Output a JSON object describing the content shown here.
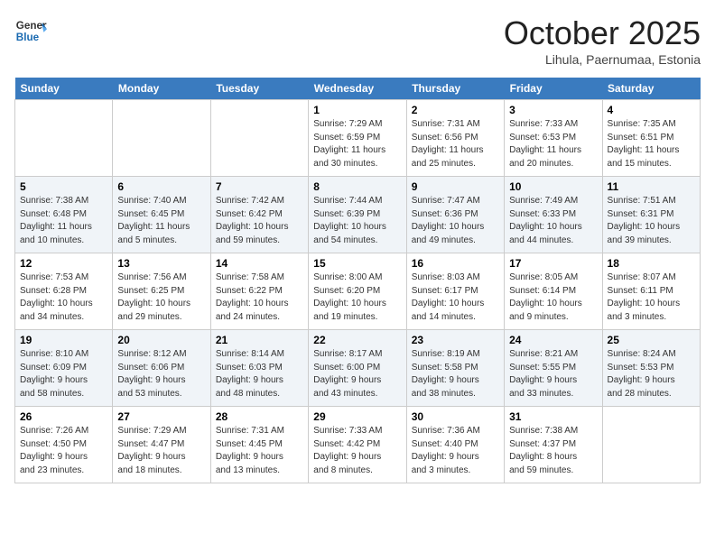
{
  "header": {
    "logo_line1": "General",
    "logo_line2": "Blue",
    "month": "October 2025",
    "location": "Lihula, Paernumaa, Estonia"
  },
  "days_of_week": [
    "Sunday",
    "Monday",
    "Tuesday",
    "Wednesday",
    "Thursday",
    "Friday",
    "Saturday"
  ],
  "weeks": [
    [
      {
        "day": "",
        "info": ""
      },
      {
        "day": "",
        "info": ""
      },
      {
        "day": "",
        "info": ""
      },
      {
        "day": "1",
        "info": "Sunrise: 7:29 AM\nSunset: 6:59 PM\nDaylight: 11 hours\nand 30 minutes."
      },
      {
        "day": "2",
        "info": "Sunrise: 7:31 AM\nSunset: 6:56 PM\nDaylight: 11 hours\nand 25 minutes."
      },
      {
        "day": "3",
        "info": "Sunrise: 7:33 AM\nSunset: 6:53 PM\nDaylight: 11 hours\nand 20 minutes."
      },
      {
        "day": "4",
        "info": "Sunrise: 7:35 AM\nSunset: 6:51 PM\nDaylight: 11 hours\nand 15 minutes."
      }
    ],
    [
      {
        "day": "5",
        "info": "Sunrise: 7:38 AM\nSunset: 6:48 PM\nDaylight: 11 hours\nand 10 minutes."
      },
      {
        "day": "6",
        "info": "Sunrise: 7:40 AM\nSunset: 6:45 PM\nDaylight: 11 hours\nand 5 minutes."
      },
      {
        "day": "7",
        "info": "Sunrise: 7:42 AM\nSunset: 6:42 PM\nDaylight: 10 hours\nand 59 minutes."
      },
      {
        "day": "8",
        "info": "Sunrise: 7:44 AM\nSunset: 6:39 PM\nDaylight: 10 hours\nand 54 minutes."
      },
      {
        "day": "9",
        "info": "Sunrise: 7:47 AM\nSunset: 6:36 PM\nDaylight: 10 hours\nand 49 minutes."
      },
      {
        "day": "10",
        "info": "Sunrise: 7:49 AM\nSunset: 6:33 PM\nDaylight: 10 hours\nand 44 minutes."
      },
      {
        "day": "11",
        "info": "Sunrise: 7:51 AM\nSunset: 6:31 PM\nDaylight: 10 hours\nand 39 minutes."
      }
    ],
    [
      {
        "day": "12",
        "info": "Sunrise: 7:53 AM\nSunset: 6:28 PM\nDaylight: 10 hours\nand 34 minutes."
      },
      {
        "day": "13",
        "info": "Sunrise: 7:56 AM\nSunset: 6:25 PM\nDaylight: 10 hours\nand 29 minutes."
      },
      {
        "day": "14",
        "info": "Sunrise: 7:58 AM\nSunset: 6:22 PM\nDaylight: 10 hours\nand 24 minutes."
      },
      {
        "day": "15",
        "info": "Sunrise: 8:00 AM\nSunset: 6:20 PM\nDaylight: 10 hours\nand 19 minutes."
      },
      {
        "day": "16",
        "info": "Sunrise: 8:03 AM\nSunset: 6:17 PM\nDaylight: 10 hours\nand 14 minutes."
      },
      {
        "day": "17",
        "info": "Sunrise: 8:05 AM\nSunset: 6:14 PM\nDaylight: 10 hours\nand 9 minutes."
      },
      {
        "day": "18",
        "info": "Sunrise: 8:07 AM\nSunset: 6:11 PM\nDaylight: 10 hours\nand 3 minutes."
      }
    ],
    [
      {
        "day": "19",
        "info": "Sunrise: 8:10 AM\nSunset: 6:09 PM\nDaylight: 9 hours\nand 58 minutes."
      },
      {
        "day": "20",
        "info": "Sunrise: 8:12 AM\nSunset: 6:06 PM\nDaylight: 9 hours\nand 53 minutes."
      },
      {
        "day": "21",
        "info": "Sunrise: 8:14 AM\nSunset: 6:03 PM\nDaylight: 9 hours\nand 48 minutes."
      },
      {
        "day": "22",
        "info": "Sunrise: 8:17 AM\nSunset: 6:00 PM\nDaylight: 9 hours\nand 43 minutes."
      },
      {
        "day": "23",
        "info": "Sunrise: 8:19 AM\nSunset: 5:58 PM\nDaylight: 9 hours\nand 38 minutes."
      },
      {
        "day": "24",
        "info": "Sunrise: 8:21 AM\nSunset: 5:55 PM\nDaylight: 9 hours\nand 33 minutes."
      },
      {
        "day": "25",
        "info": "Sunrise: 8:24 AM\nSunset: 5:53 PM\nDaylight: 9 hours\nand 28 minutes."
      }
    ],
    [
      {
        "day": "26",
        "info": "Sunrise: 7:26 AM\nSunset: 4:50 PM\nDaylight: 9 hours\nand 23 minutes."
      },
      {
        "day": "27",
        "info": "Sunrise: 7:29 AM\nSunset: 4:47 PM\nDaylight: 9 hours\nand 18 minutes."
      },
      {
        "day": "28",
        "info": "Sunrise: 7:31 AM\nSunset: 4:45 PM\nDaylight: 9 hours\nand 13 minutes."
      },
      {
        "day": "29",
        "info": "Sunrise: 7:33 AM\nSunset: 4:42 PM\nDaylight: 9 hours\nand 8 minutes."
      },
      {
        "day": "30",
        "info": "Sunrise: 7:36 AM\nSunset: 4:40 PM\nDaylight: 9 hours\nand 3 minutes."
      },
      {
        "day": "31",
        "info": "Sunrise: 7:38 AM\nSunset: 4:37 PM\nDaylight: 8 hours\nand 59 minutes."
      },
      {
        "day": "",
        "info": ""
      }
    ]
  ]
}
